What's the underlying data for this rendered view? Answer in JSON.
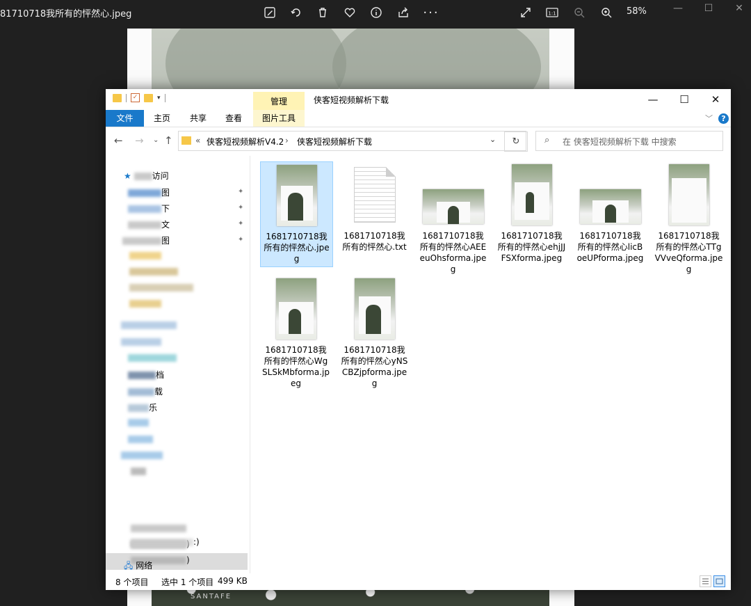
{
  "viewer": {
    "title": "81710718我所有的怦然心.jpeg",
    "zoom": "58%",
    "toolbar_icons": [
      "edit-image-icon",
      "rotate-icon",
      "delete-icon",
      "heart-icon",
      "info-icon",
      "share-icon",
      "more-icon"
    ],
    "right_icons": [
      "fullscreen-icon",
      "actual-size-icon",
      "zoom-out-icon",
      "zoom-in-icon"
    ],
    "window_controls": {
      "minimize": "—",
      "maximize": "☐",
      "close": "✕"
    }
  },
  "photo": {
    "watermark": "SANTAFE"
  },
  "explorer": {
    "context_tab": "管理",
    "window_title": "侠客短视频解析下载",
    "ribbon_tabs": [
      {
        "label": "文件"
      },
      {
        "label": "主页"
      },
      {
        "label": "共享"
      },
      {
        "label": "查看"
      },
      {
        "label": "图片工具"
      }
    ],
    "address": {
      "prefix": "«",
      "crumbs": [
        "侠客短视频解析V4.2",
        "侠客短视频解析下载"
      ],
      "separator": "›"
    },
    "search_placeholder": "在 侠客短视频解析下载 中搜索",
    "nav": {
      "quick_access": "访问",
      "items": [
        "图",
        "下",
        "文",
        "图",
        "",
        "",
        " ",
        "",
        "",
        "",
        "",
        "档",
        "载",
        "乐",
        "",
        "",
        ")",
        ")",
        "",
        "",
        "",
        ":)"
      ],
      "network": "网络"
    },
    "files": [
      {
        "name": "1681710718我所有的怦然心.jpeg",
        "type": "jpeg",
        "selected": true
      },
      {
        "name": "1681710718我所有的怦然心.txt",
        "type": "txt",
        "selected": false
      },
      {
        "name": "1681710718我所有的怦然心AEEeuOhsforma.jpeg",
        "type": "jpeg-wide",
        "selected": false
      },
      {
        "name": "1681710718我所有的怦然心ehjJJFSXforma.jpeg",
        "type": "jpeg",
        "selected": false
      },
      {
        "name": "1681710718我所有的怦然心licBoeUPforma.jpeg",
        "type": "jpeg-wide",
        "selected": false
      },
      {
        "name": "1681710718我所有的怦然心TTgVVveQforma.jpeg",
        "type": "jpeg",
        "selected": false
      },
      {
        "name": "1681710718我所有的怦然心WgSLSkMbforma.jpeg",
        "type": "jpeg",
        "selected": false
      },
      {
        "name": "1681710718我所有的怦然心yNSCBZjpforma.jpeg",
        "type": "jpeg",
        "selected": false
      }
    ],
    "status": {
      "count": "8 个项目",
      "selection": "选中 1 个项目",
      "size": "499 KB"
    }
  }
}
